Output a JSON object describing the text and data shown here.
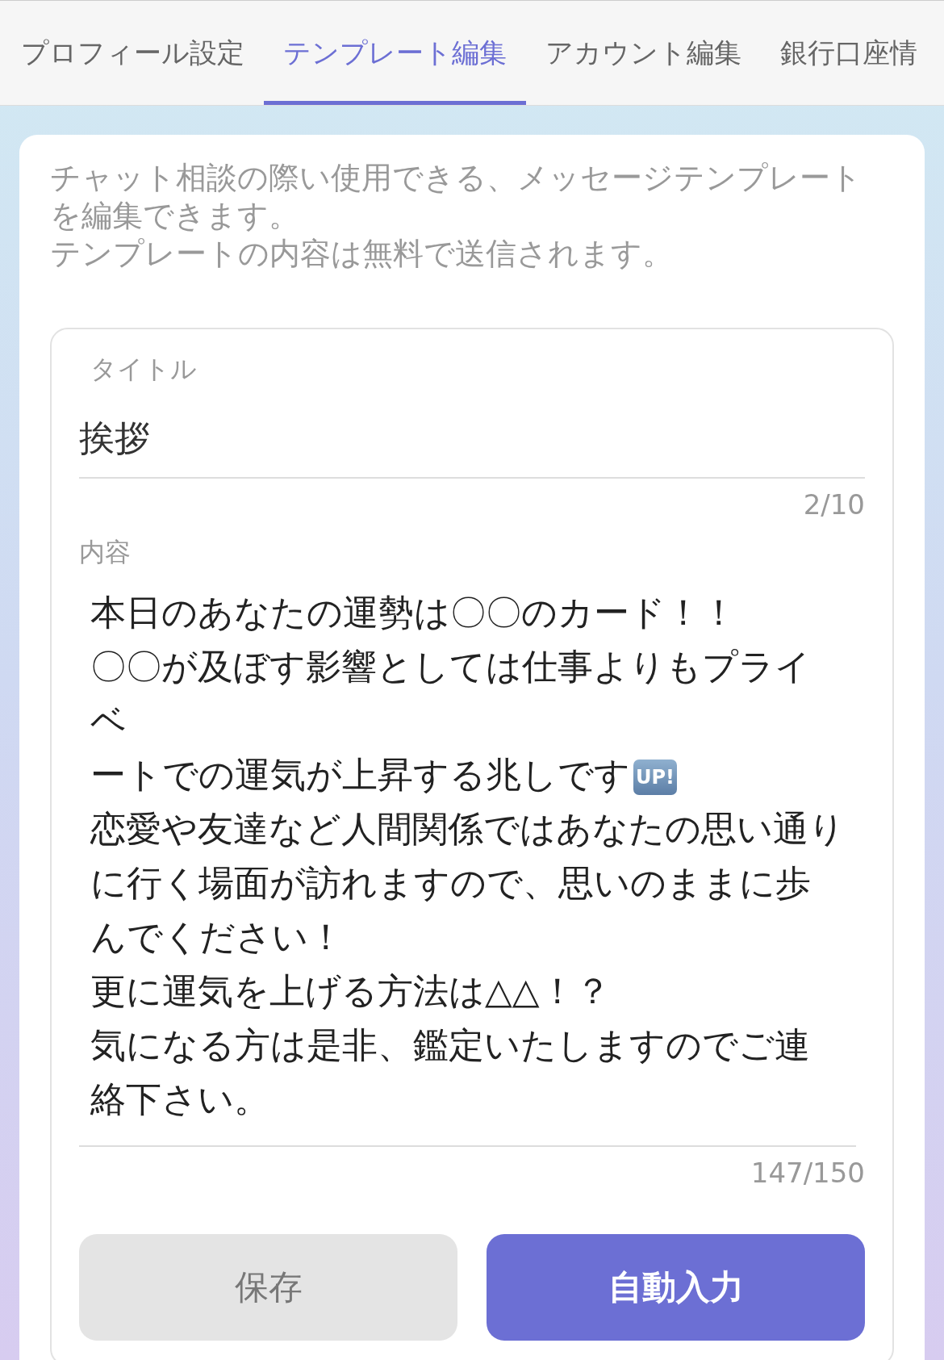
{
  "tabs": [
    {
      "label": "プロフィール設定",
      "selected": false
    },
    {
      "label": "テンプレート編集",
      "selected": true
    },
    {
      "label": "アカウント編集",
      "selected": false
    },
    {
      "label": "銀行口座情",
      "selected": false
    }
  ],
  "description": [
    "チャット相談の際い使用できる、メッセージテンプレートを編集できます。",
    "テンプレートの内容は無料で送信されます。"
  ],
  "title_field": {
    "label": "タイトル",
    "value": "挨拶",
    "counter": "2/10"
  },
  "content_field": {
    "label": "内容",
    "lines": [
      {
        "text": "本日のあなたの運勢は〇〇のカード！！"
      },
      {
        "text": "〇〇が及ぼす影響としては仕事よりもプライベ"
      },
      {
        "text": "ートでの運気が上昇する兆しです",
        "badge": "UP!"
      },
      {
        "text": "恋愛や友達など人間関係ではあなたの思い通りに行く場面が訪れますので、思いのままに歩んでください！"
      },
      {
        "text": "更に運気を上げる方法は△△！？"
      },
      {
        "text": "気になる方は是非、鑑定いたしますのでご連絡下さい。"
      }
    ],
    "counter": "147/150"
  },
  "buttons": [
    {
      "label": "保存",
      "kind": "secondary",
      "disabled": true
    },
    {
      "label": "自動入力",
      "kind": "primary",
      "disabled": false
    }
  ]
}
